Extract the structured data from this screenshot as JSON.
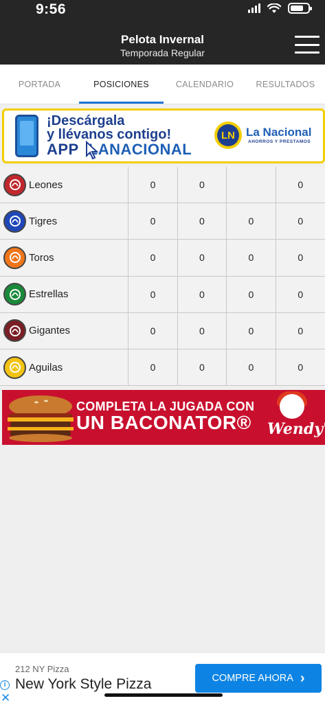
{
  "status_bar": {
    "time": "9:56"
  },
  "header": {
    "title": "Pelota Invernal",
    "subtitle": "Temporada Regular"
  },
  "tabs": [
    {
      "label": "PORTADA"
    },
    {
      "label": "POSICIONES",
      "active": true
    },
    {
      "label": "CALENDARIO"
    },
    {
      "label": "RESULTADOS"
    }
  ],
  "banner_ad": {
    "line1": "¡Descárgala",
    "line2": "y llévanos contigo!",
    "line3_app": "APP",
    "line3_brand": "LANACIONAL",
    "logo_text": "LN",
    "brand": "La Nacional",
    "brand_sub": "AHORROS Y PRESTAMOS"
  },
  "standings": [
    {
      "team": "Leones",
      "icon": "lion-logo-icon",
      "color": "#c0282d",
      "stats": [
        "0",
        "0",
        "",
        "0"
      ]
    },
    {
      "team": "Tigres",
      "icon": "tiger-logo-icon",
      "color": "#1f47b8",
      "stats": [
        "0",
        "0",
        "0",
        "0"
      ]
    },
    {
      "team": "Toros",
      "icon": "bull-logo-icon",
      "color": "#f0761c",
      "stats": [
        "0",
        "0",
        "0",
        "0"
      ]
    },
    {
      "team": "Estrellas",
      "icon": "star-logo-icon",
      "color": "#1a8a3a",
      "stats": [
        "0",
        "0",
        "0",
        "0"
      ]
    },
    {
      "team": "Gigantes",
      "icon": "giant-logo-icon",
      "color": "#7a1f25",
      "stats": [
        "0",
        "0",
        "0",
        "0"
      ]
    },
    {
      "team": "Aguilas",
      "icon": "eagle-logo-icon",
      "color": "#f2c312",
      "stats": [
        "0",
        "0",
        "0",
        "0"
      ]
    }
  ],
  "promo_ad": {
    "line1": "COMPLETA LA JUGADA CON",
    "line2": "UN BACONATOR®",
    "brand": "Wendy's"
  },
  "bottom_ad": {
    "advertiser": "212 NY Pizza",
    "headline": "New York Style Pizza",
    "cta": "COMPRE AHORA"
  },
  "colors": {
    "header_bg": "#262626",
    "active_tab_underline": "#1b73d4",
    "banner_border": "#f4cd00",
    "promo_bg": "#c8102e",
    "cta_bg": "#0d84e3"
  }
}
